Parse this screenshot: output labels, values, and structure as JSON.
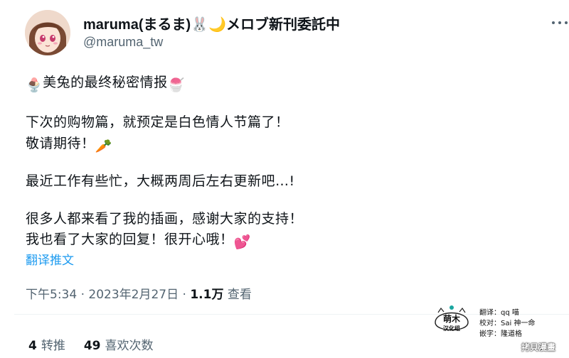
{
  "tweet": {
    "display_name": "maruma(まるま)",
    "display_name_emoji": "🐰🌙",
    "display_name_suffix": "メロブ新刊委託中",
    "handle": "@maruma_tw",
    "body_lines": [
      {
        "text": "美兔的最终秘密情报",
        "lead_emoji": "🍨",
        "trail_emoji": "🍧"
      },
      {
        "text": "下次的购物篇，就预定是白色情人节篇了！"
      },
      {
        "text": "敬请期待！",
        "trail_emoji": "🥕"
      },
      {
        "text": "最近工作有些忙，大概两周后左右更新吧…!"
      },
      {
        "text": "很多人都来看了我的插画，感谢大家的支持！"
      },
      {
        "text": "我也看了大家的回复！很开心哦！",
        "trail_emoji": "💕"
      }
    ],
    "translate_label": "翻译推文",
    "time": "下午5:34",
    "date": "2023年2月27日",
    "views_count": "1.1万",
    "views_label": "查看",
    "retweets_count": "4",
    "retweets_label": "转推",
    "likes_count": "49",
    "likes_label": "喜欢次数"
  },
  "credits": {
    "logo_text": [
      "萌木",
      "汉化组"
    ],
    "lines": [
      "翻译：qq 喵",
      "校对：Sai 神一命",
      "嵌字：隆道格"
    ]
  },
  "watermark": "拷貝漫畫"
}
